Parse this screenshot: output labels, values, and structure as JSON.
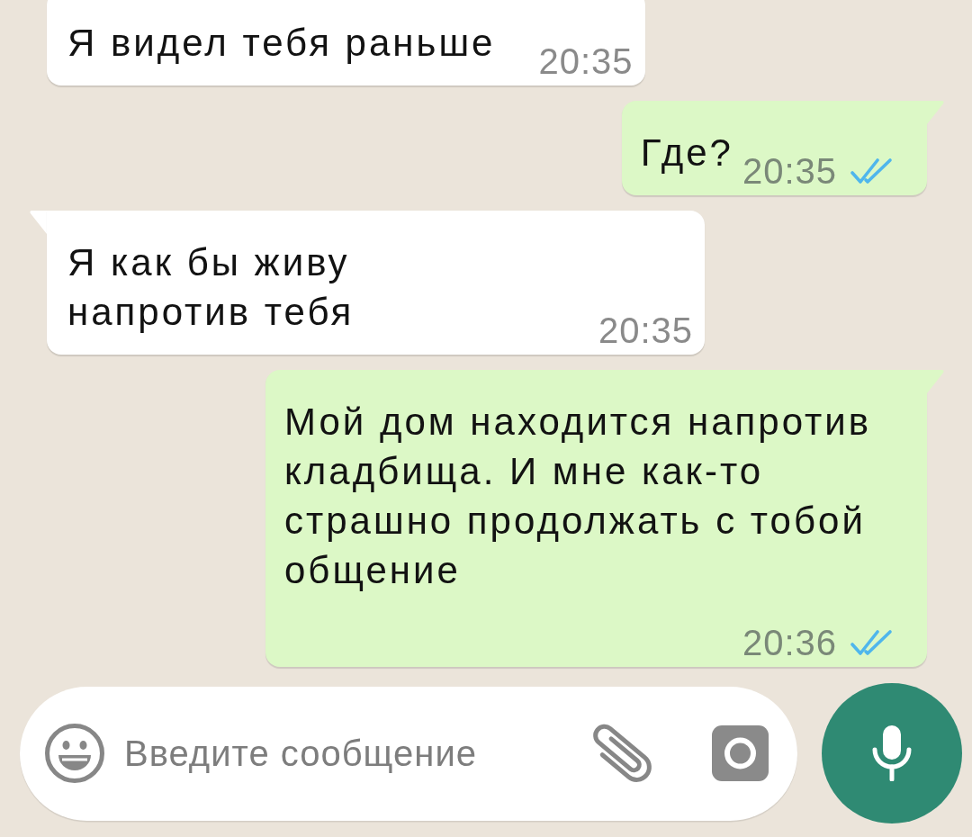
{
  "messages": [
    {
      "kind": "incoming",
      "tail": false,
      "text": "Я видел тебя раньше",
      "time": "20:35"
    },
    {
      "kind": "outgoing",
      "tail": true,
      "text": "Где?",
      "time": "20:35",
      "read": true
    },
    {
      "kind": "incoming",
      "tail": true,
      "text": "Я как бы живу\nнапротив тебя",
      "time": "20:35"
    },
    {
      "kind": "outgoing",
      "tail": true,
      "text": "Мой дом находится напротив кладбища. И мне как-то страшно продолжать с тобой общение",
      "time": "20:36",
      "read": true
    }
  ],
  "composer": {
    "placeholder": "Введите сообщение"
  }
}
